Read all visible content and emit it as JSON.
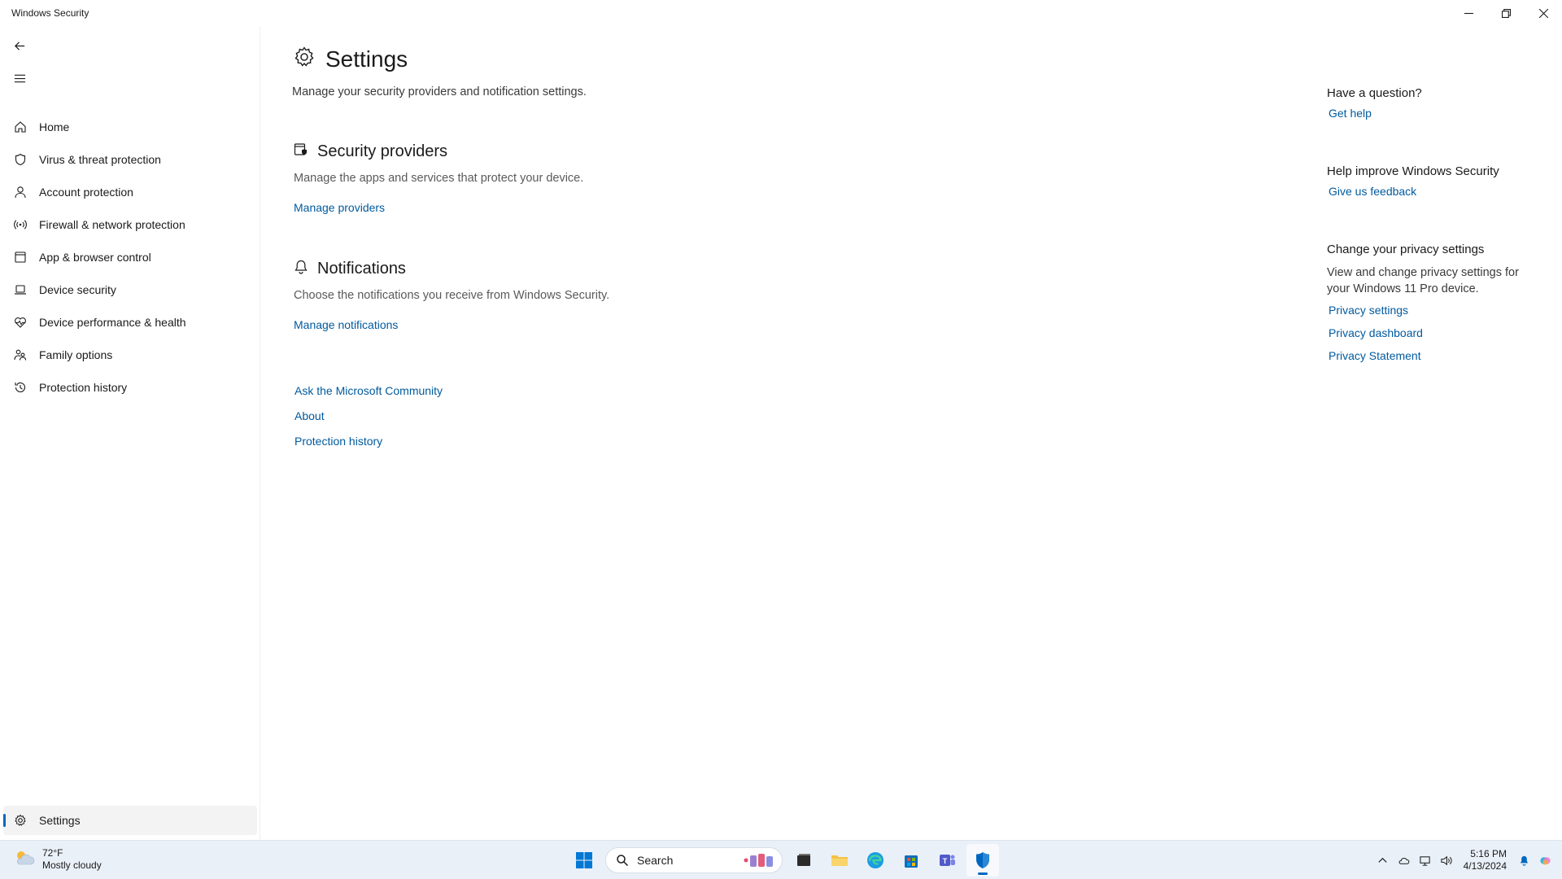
{
  "window": {
    "title": "Windows Security"
  },
  "sidebar": {
    "items": [
      {
        "label": "Home",
        "icon": "home-icon"
      },
      {
        "label": "Virus & threat protection",
        "icon": "shield-icon"
      },
      {
        "label": "Account protection",
        "icon": "person-icon"
      },
      {
        "label": "Firewall & network protection",
        "icon": "wifi-icon"
      },
      {
        "label": "App & browser control",
        "icon": "app-window-icon"
      },
      {
        "label": "Device security",
        "icon": "laptop-icon"
      },
      {
        "label": "Device performance & health",
        "icon": "heart-icon"
      },
      {
        "label": "Family options",
        "icon": "family-icon"
      },
      {
        "label": "Protection history",
        "icon": "history-icon"
      }
    ],
    "settings_label": "Settings"
  },
  "main": {
    "title": "Settings",
    "description": "Manage your security providers and notification settings.",
    "providers": {
      "title": "Security providers",
      "description": "Manage the apps and services that protect your device.",
      "link": "Manage providers"
    },
    "notifications": {
      "title": "Notifications",
      "description": "Choose the notifications you receive from Windows Security.",
      "link": "Manage notifications"
    },
    "links": [
      "Ask the Microsoft Community",
      "About",
      "Protection history"
    ]
  },
  "right": {
    "question": {
      "heading": "Have a question?",
      "link": "Get help"
    },
    "improve": {
      "heading": "Help improve Windows Security",
      "link": "Give us feedback"
    },
    "privacy": {
      "heading": "Change your privacy settings",
      "text": "View and change privacy settings for your Windows 11 Pro device.",
      "links": [
        "Privacy settings",
        "Privacy dashboard",
        "Privacy Statement"
      ]
    }
  },
  "taskbar": {
    "weather": {
      "temp": "72°F",
      "condition": "Mostly cloudy"
    },
    "search_label": "Search",
    "time": "5:16 PM",
    "date": "4/13/2024"
  },
  "colors": {
    "accent": "#0067c0",
    "link": "#005a9e",
    "taskbar": "#eaf0f8"
  }
}
